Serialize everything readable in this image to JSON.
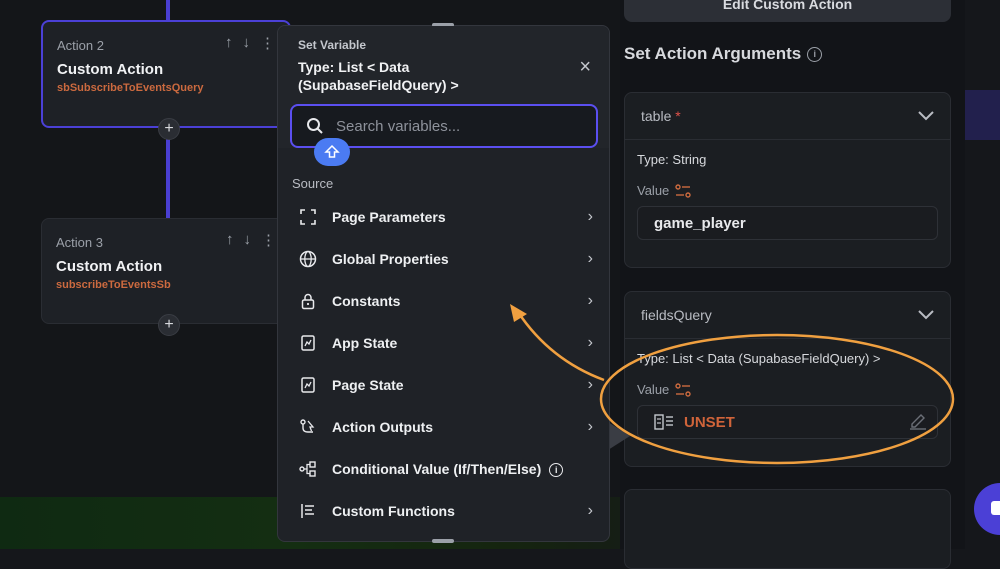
{
  "canvas": {
    "nodes": [
      {
        "step": "Action 2",
        "title": "Custom Action",
        "sub": "sbSubscribeToEventsQuery"
      },
      {
        "step": "Action 3",
        "title": "Custom Action",
        "sub": "subscribeToEventsSb"
      }
    ],
    "plus": "+",
    "tools": [
      "↑",
      "↓",
      "⋮"
    ]
  },
  "popup": {
    "kicker": "Set Variable",
    "type_line": "Type: List < Data (SupabaseFieldQuery) >",
    "close": "×",
    "search_placeholder": "Search variables...",
    "source_label": "Source",
    "items": [
      {
        "label": "Page Parameters",
        "icon": "page-parameters-icon",
        "has_chevron": true
      },
      {
        "label": "Global Properties",
        "icon": "globe-icon",
        "has_chevron": true
      },
      {
        "label": "Constants",
        "icon": "lock-icon",
        "has_chevron": true
      },
      {
        "label": "App State",
        "icon": "app-state-icon",
        "has_chevron": true
      },
      {
        "label": "Page State",
        "icon": "page-state-icon",
        "has_chevron": true
      },
      {
        "label": "Action Outputs",
        "icon": "action-outputs-icon",
        "has_chevron": true
      },
      {
        "label": "Conditional Value (If/Then/Else)",
        "icon": "conditional-icon",
        "has_chevron": false
      },
      {
        "label": "Custom Functions",
        "icon": "custom-functions-icon",
        "has_chevron": true
      }
    ],
    "chevron": "›"
  },
  "right_panel": {
    "edit_button": "Edit Custom Action",
    "section_title": "Set Action Arguments",
    "args": [
      {
        "name": "table",
        "required_mark": "*",
        "type": "Type: String",
        "value_label": "Value",
        "value": "game_player"
      },
      {
        "name": "fieldsQuery",
        "required_mark": "",
        "type": "Type: List < Data (SupabaseFieldQuery) >",
        "value_label": "Value",
        "value": "UNSET"
      }
    ]
  },
  "colors": {
    "accent": "#4b40d6",
    "annotation": "#f0a040",
    "unset": "#d0643a"
  }
}
